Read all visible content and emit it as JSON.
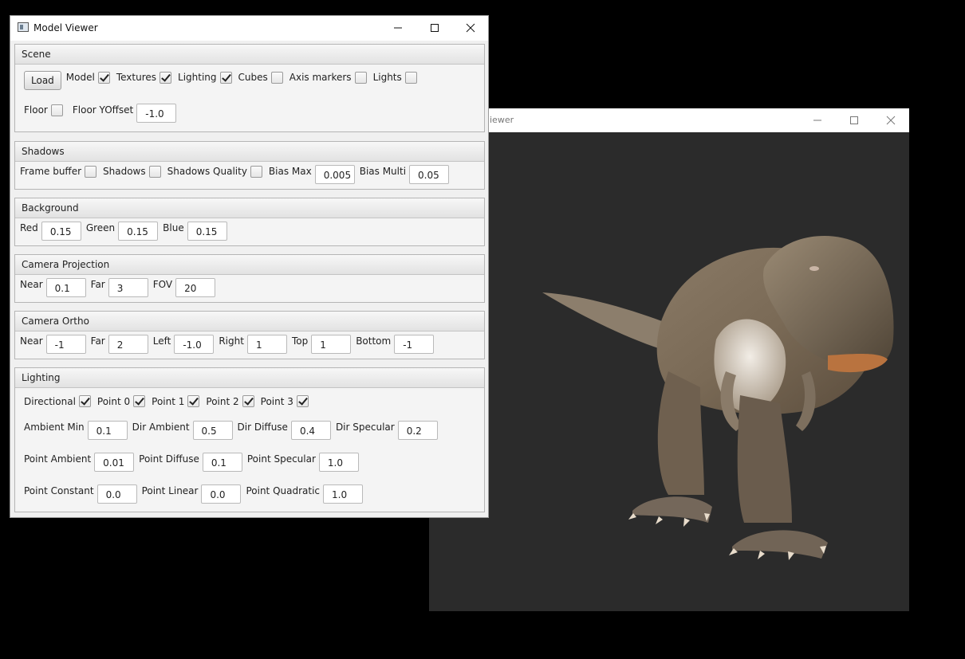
{
  "viewer": {
    "title": "iewer"
  },
  "panel": {
    "title": "Model Viewer",
    "scene": {
      "header": "Scene",
      "load_label": "Load",
      "model_label": "Model",
      "model_checked": true,
      "textures_label": "Textures",
      "textures_checked": true,
      "lighting_label": "Lighting",
      "lighting_checked": true,
      "cubes_label": "Cubes",
      "cubes_checked": false,
      "axis_label": "Axis markers",
      "axis_checked": false,
      "lights_label": "Lights",
      "lights_checked": false,
      "floor_label": "Floor",
      "floor_checked": false,
      "floor_yoffset_label": "Floor YOffset",
      "floor_yoffset_value": "-1.0"
    },
    "shadows": {
      "header": "Shadows",
      "framebuffer_label": "Frame buffer",
      "framebuffer_checked": false,
      "shadows_label": "Shadows",
      "shadows_checked": false,
      "quality_label": "Shadows Quality",
      "quality_checked": false,
      "bias_max_label": "Bias Max",
      "bias_max_value": "0.005",
      "bias_multi_label": "Bias Multi",
      "bias_multi_value": "0.05"
    },
    "background": {
      "header": "Background",
      "red_label": "Red",
      "red_value": "0.15",
      "green_label": "Green",
      "green_value": "0.15",
      "blue_label": "Blue",
      "blue_value": "0.15"
    },
    "camera_projection": {
      "header": "Camera Projection",
      "near_label": "Near",
      "near_value": "0.1",
      "far_label": "Far",
      "far_value": "3",
      "fov_label": "FOV",
      "fov_value": "20"
    },
    "camera_ortho": {
      "header": "Camera Ortho",
      "near_label": "Near",
      "near_value": "-1",
      "far_label": "Far",
      "far_value": "2",
      "left_label": "Left",
      "left_value": "-1.0",
      "right_label": "Right",
      "right_value": "1",
      "top_label": "Top",
      "top_value": "1",
      "bottom_label": "Bottom",
      "bottom_value": "-1"
    },
    "lighting": {
      "header": "Lighting",
      "directional_label": "Directional",
      "directional_checked": true,
      "point0_label": "Point 0",
      "point0_checked": true,
      "point1_label": "Point 1",
      "point1_checked": true,
      "point2_label": "Point 2",
      "point2_checked": true,
      "point3_label": "Point 3",
      "point3_checked": true,
      "ambient_min_label": "Ambient Min",
      "ambient_min_value": "0.1",
      "dir_ambient_label": "Dir Ambient",
      "dir_ambient_value": "0.5",
      "dir_diffuse_label": "Dir Diffuse",
      "dir_diffuse_value": "0.4",
      "dir_specular_label": "Dir Specular",
      "dir_specular_value": "0.2",
      "point_ambient_label": "Point Ambient",
      "point_ambient_value": "0.01",
      "point_diffuse_label": "Point Diffuse",
      "point_diffuse_value": "0.1",
      "point_specular_label": "Point Specular",
      "point_specular_value": "1.0",
      "point_constant_label": "Point Constant",
      "point_constant_value": "0.0",
      "point_linear_label": "Point Linear",
      "point_linear_value": "0.0",
      "point_quadratic_label": "Point Quadratic",
      "point_quadratic_value": "1.0"
    }
  },
  "colors": {
    "viewport_bg": "#2b2b2b",
    "desktop_bg": "#000000"
  }
}
